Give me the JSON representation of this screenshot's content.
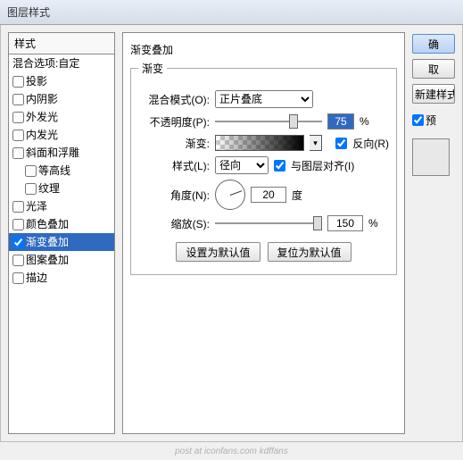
{
  "window": {
    "title": "图层样式"
  },
  "sidebar": {
    "header": "样式",
    "items": [
      {
        "label": "混合选项:自定",
        "checkbox": false,
        "selected": false
      },
      {
        "label": "投影",
        "checkbox": true,
        "checked": false
      },
      {
        "label": "内阴影",
        "checkbox": true,
        "checked": false
      },
      {
        "label": "外发光",
        "checkbox": true,
        "checked": false
      },
      {
        "label": "内发光",
        "checkbox": true,
        "checked": false
      },
      {
        "label": "斜面和浮雕",
        "checkbox": true,
        "checked": false
      },
      {
        "label": "等高线",
        "checkbox": true,
        "checked": false,
        "indent": true
      },
      {
        "label": "纹理",
        "checkbox": true,
        "checked": false,
        "indent": true
      },
      {
        "label": "光泽",
        "checkbox": true,
        "checked": false
      },
      {
        "label": "颜色叠加",
        "checkbox": true,
        "checked": false
      },
      {
        "label": "渐变叠加",
        "checkbox": true,
        "checked": true,
        "selected": true
      },
      {
        "label": "图案叠加",
        "checkbox": true,
        "checked": false
      },
      {
        "label": "描边",
        "checkbox": true,
        "checked": false
      }
    ]
  },
  "main": {
    "groupTitle": "渐变叠加",
    "legend": "渐变",
    "blendMode": {
      "label": "混合模式(O):",
      "value": "正片叠底"
    },
    "opacity": {
      "label": "不透明度(P):",
      "value": "75",
      "unit": "%"
    },
    "gradient": {
      "label": "渐变:",
      "reverseLabel": "反向(R)",
      "reverseChecked": true
    },
    "style": {
      "label": "样式(L):",
      "value": "径向",
      "alignLabel": "与图层对齐(I)",
      "alignChecked": true
    },
    "angle": {
      "label": "角度(N):",
      "value": "20",
      "unit": "度"
    },
    "scale": {
      "label": "缩放(S):",
      "value": "150",
      "unit": "%"
    },
    "defaultsBtn": "设置为默认值",
    "resetBtn": "复位为默认值"
  },
  "right": {
    "ok": "确",
    "cancel": "取",
    "newStyle": "新建样式",
    "previewLabel": "预"
  },
  "footer": "post at iconfans.com  kdffans"
}
